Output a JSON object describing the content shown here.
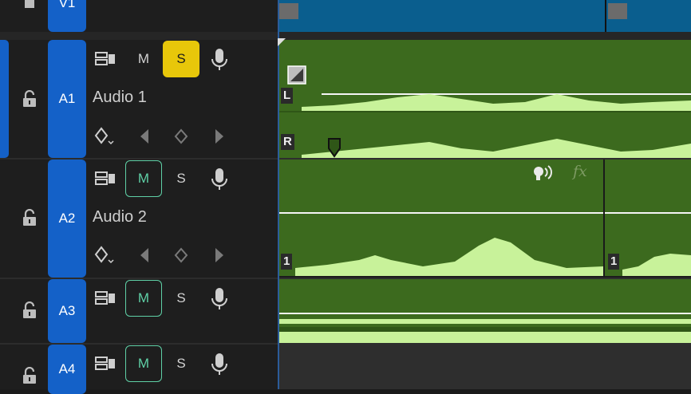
{
  "tracks": {
    "v1": {
      "label": "V1"
    },
    "a1": {
      "label": "A1",
      "name": "Audio 1",
      "mute": "M",
      "solo": "S"
    },
    "a2": {
      "label": "A2",
      "name": "Audio 2",
      "mute": "M",
      "solo": "S"
    },
    "a3": {
      "label": "A3",
      "mute": "M",
      "solo": "S"
    },
    "a4": {
      "label": "A4",
      "mute": "M",
      "solo": "S"
    }
  },
  "clips": {
    "a1_left_channel": "L",
    "a1_right_channel": "R",
    "a2_clip1_channel": "1",
    "a2_clip2_channel": "1",
    "fx_badge": "fx"
  },
  "colors": {
    "track_tag": "#1461c8",
    "solo_active": "#e8c70a",
    "mute_active": "#5fd0a6",
    "audio_clip": "#3c6a1e",
    "waveform": "#c8f29a",
    "video_clip": "#0a5e8e"
  }
}
